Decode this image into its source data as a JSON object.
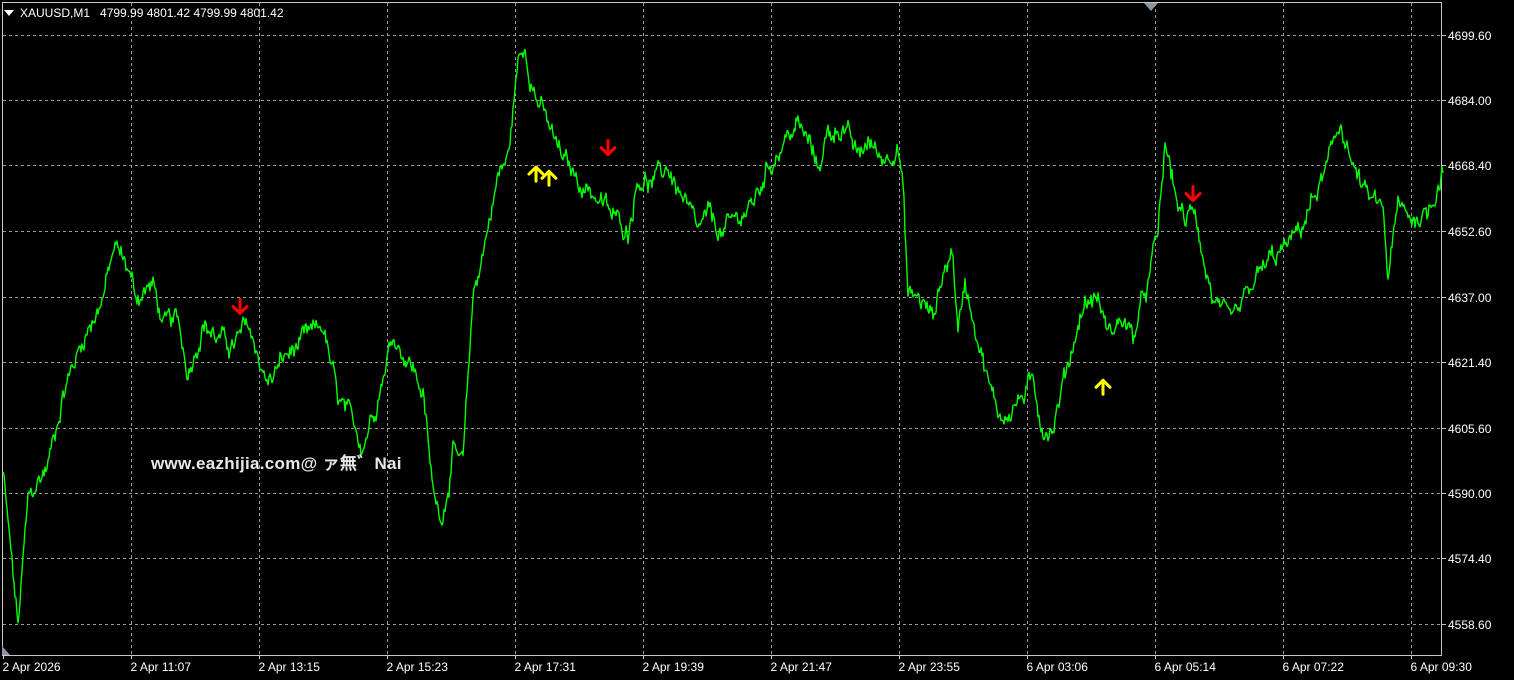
{
  "header": {
    "symbol": "XAUUSD,M1",
    "ohlc": "4799.99 4801.42 4799.99 4801.42",
    "menu_icon": "triangle-down-icon"
  },
  "watermark": "www.eazhijia.com@ ァ無゛Nai",
  "colors": {
    "background": "#000000",
    "grid": "#9a9a9a",
    "price_line": "#00ff00",
    "buy_arrow": "#ffff00",
    "sell_arrow": "#ff0000",
    "text": "#ffffff"
  },
  "chart_data": {
    "type": "line",
    "title": "",
    "xlabel": "",
    "ylabel": "",
    "ylim": [
      4552,
      4712
    ],
    "y_ticks": [
      "4699.60",
      "4684.00",
      "4668.40",
      "4652.60",
      "4637.00",
      "4621.40",
      "4605.60",
      "4590.00",
      "4574.40",
      "4558.60"
    ],
    "x_ticks": [
      "2 Apr 2026",
      "2 Apr 11:07",
      "2 Apr 13:15",
      "2 Apr 15:23",
      "2 Apr 17:31",
      "2 Apr 19:39",
      "2 Apr 21:47",
      "2 Apr 23:55",
      "6 Apr 03:06",
      "6 Apr 05:14",
      "6 Apr 07:22",
      "6 Apr 09:30"
    ],
    "grid": true,
    "series": [
      {
        "x_index": [
          0,
          15,
          25,
          45,
          60,
          80,
          100,
          112,
          125,
          133,
          150,
          160,
          175,
          185,
          200,
          215,
          230,
          245,
          255,
          265,
          280,
          300,
          320,
          335,
          345,
          360,
          375,
          390,
          410,
          420,
          430,
          440,
          450,
          460,
          470,
          480,
          495,
          505,
          515,
          522,
          532,
          545,
          555,
          565,
          575,
          590,
          600,
          610,
          625,
          635,
          650,
          665,
          680,
          695,
          705,
          720,
          735,
          750,
          765,
          780,
          795,
          805,
          815,
          825,
          840,
          855,
          865,
          880,
          895,
          900,
          905,
          915,
          930,
          940,
          950,
          955,
          962,
          975,
          990,
          1000,
          1015,
          1030,
          1040,
          1050,
          1065,
          1080,
          1095,
          1105,
          1120,
          1130,
          1145,
          1155,
          1162,
          1172,
          1182,
          1192,
          1202,
          1212,
          1225,
          1235,
          1250,
          1265,
          1280,
          1295,
          1310,
          1325,
          1338,
          1350,
          1365,
          1380,
          1385,
          1395,
          1410,
          1425,
          1437,
          1440
        ],
        "values": [
          4595,
          4558,
          4588,
          4597,
          4614,
          4627,
          4637,
          4649,
          4644,
          4637,
          4640,
          4630,
          4631,
          4619,
          4631,
          4627,
          4625,
          4630,
          4623,
          4616,
          4622,
          4626,
          4630,
          4612,
          4608,
          4602,
          4614,
          4628,
          4620,
          4614,
          4590,
          4585,
          4600,
          4596,
          4637,
          4648,
          4666,
          4670,
          4693,
          4697,
          4686,
          4678,
          4672,
          4668,
          4665,
          4662,
          4659,
          4656,
          4653,
          4666,
          4664,
          4668,
          4660,
          4652,
          4656,
          4652,
          4656,
          4659,
          4668,
          4674,
          4678,
          4674,
          4668,
          4676,
          4678,
          4670,
          4674,
          4670,
          4674,
          4663,
          4637,
          4637,
          4632,
          4643,
          4648,
          4628,
          4641,
          4628,
          4612,
          4608,
          4612,
          4616,
          4606,
          4606,
          4621,
          4635,
          4637,
          4628,
          4632,
          4627,
          4640,
          4652,
          4673,
          4662,
          4654,
          4659,
          4644,
          4635,
          4630,
          4632,
          4640,
          4645,
          4648,
          4652,
          4660,
          4668,
          4679,
          4668,
          4660,
          4658,
          4642,
          4658,
          4656,
          4657,
          4666,
          4668
        ]
      }
    ],
    "signals": [
      {
        "type": "sell",
        "x_index": 237,
        "value": 4633
      },
      {
        "type": "buy",
        "x_index": 533,
        "value": 4668
      },
      {
        "type": "buy",
        "x_index": 546,
        "value": 4667
      },
      {
        "type": "sell",
        "x_index": 605,
        "value": 4671
      },
      {
        "type": "buy",
        "x_index": 1100,
        "value": 4617
      },
      {
        "type": "sell",
        "x_index": 1190,
        "value": 4660
      }
    ]
  }
}
